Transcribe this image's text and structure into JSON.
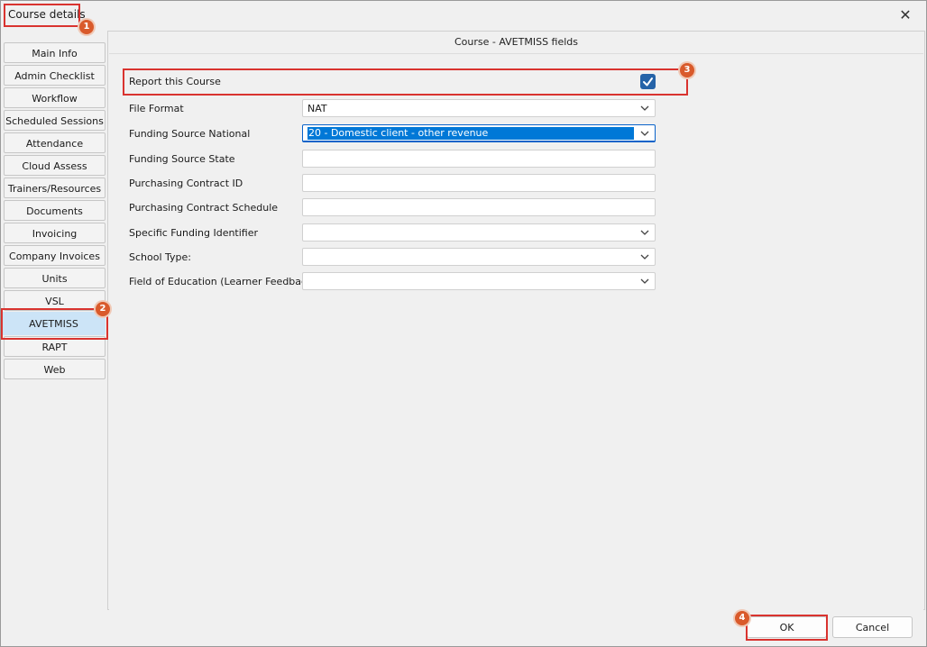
{
  "window": {
    "title": "Course details",
    "close_symbol": "✕"
  },
  "sidebar": {
    "items": [
      {
        "label": "Main Info"
      },
      {
        "label": "Admin Checklist"
      },
      {
        "label": "Workflow"
      },
      {
        "label": "Scheduled Sessions"
      },
      {
        "label": "Attendance"
      },
      {
        "label": "Cloud Assess"
      },
      {
        "label": "Trainers/Resources"
      },
      {
        "label": "Documents"
      },
      {
        "label": "Invoicing"
      },
      {
        "label": "Company Invoices"
      },
      {
        "label": "Units"
      },
      {
        "label": "VSL"
      },
      {
        "label": "AVETMISS"
      },
      {
        "label": "RAPT"
      },
      {
        "label": "Web"
      }
    ],
    "active": "AVETMISS"
  },
  "panel": {
    "title": "Course - AVETMISS fields",
    "report": {
      "label": "Report this Course",
      "checked": true
    },
    "fields": [
      {
        "label": "File Format",
        "value": "NAT",
        "type": "dropdown"
      },
      {
        "label": "Funding Source National",
        "value": "20 - Domestic client - other revenue",
        "type": "dropdown",
        "selected": true
      },
      {
        "label": "Funding Source State",
        "value": "",
        "type": "text"
      },
      {
        "label": "Purchasing Contract ID",
        "value": "",
        "type": "text"
      },
      {
        "label": "Purchasing Contract Schedule",
        "value": "",
        "type": "text"
      },
      {
        "label": "Specific Funding Identifier",
        "value": "",
        "type": "dropdown"
      },
      {
        "label": "School Type:",
        "value": "",
        "type": "dropdown"
      },
      {
        "label": "Field of Education (Learner Feedback)",
        "value": "",
        "type": "dropdown"
      }
    ]
  },
  "buttons": {
    "ok": "OK",
    "cancel": "Cancel"
  },
  "callouts": [
    {
      "number": "1"
    },
    {
      "number": "2"
    },
    {
      "number": "3"
    },
    {
      "number": "4"
    }
  ],
  "colors": {
    "accent": "#0078d7",
    "checkbox": "#2563a8",
    "callout": "#d9332f",
    "badge": "#d95a2b",
    "active_tab": "#cce4f7"
  },
  "icons": {
    "chevron": "chevron-down-icon",
    "check": "check-icon",
    "close": "close-icon"
  }
}
